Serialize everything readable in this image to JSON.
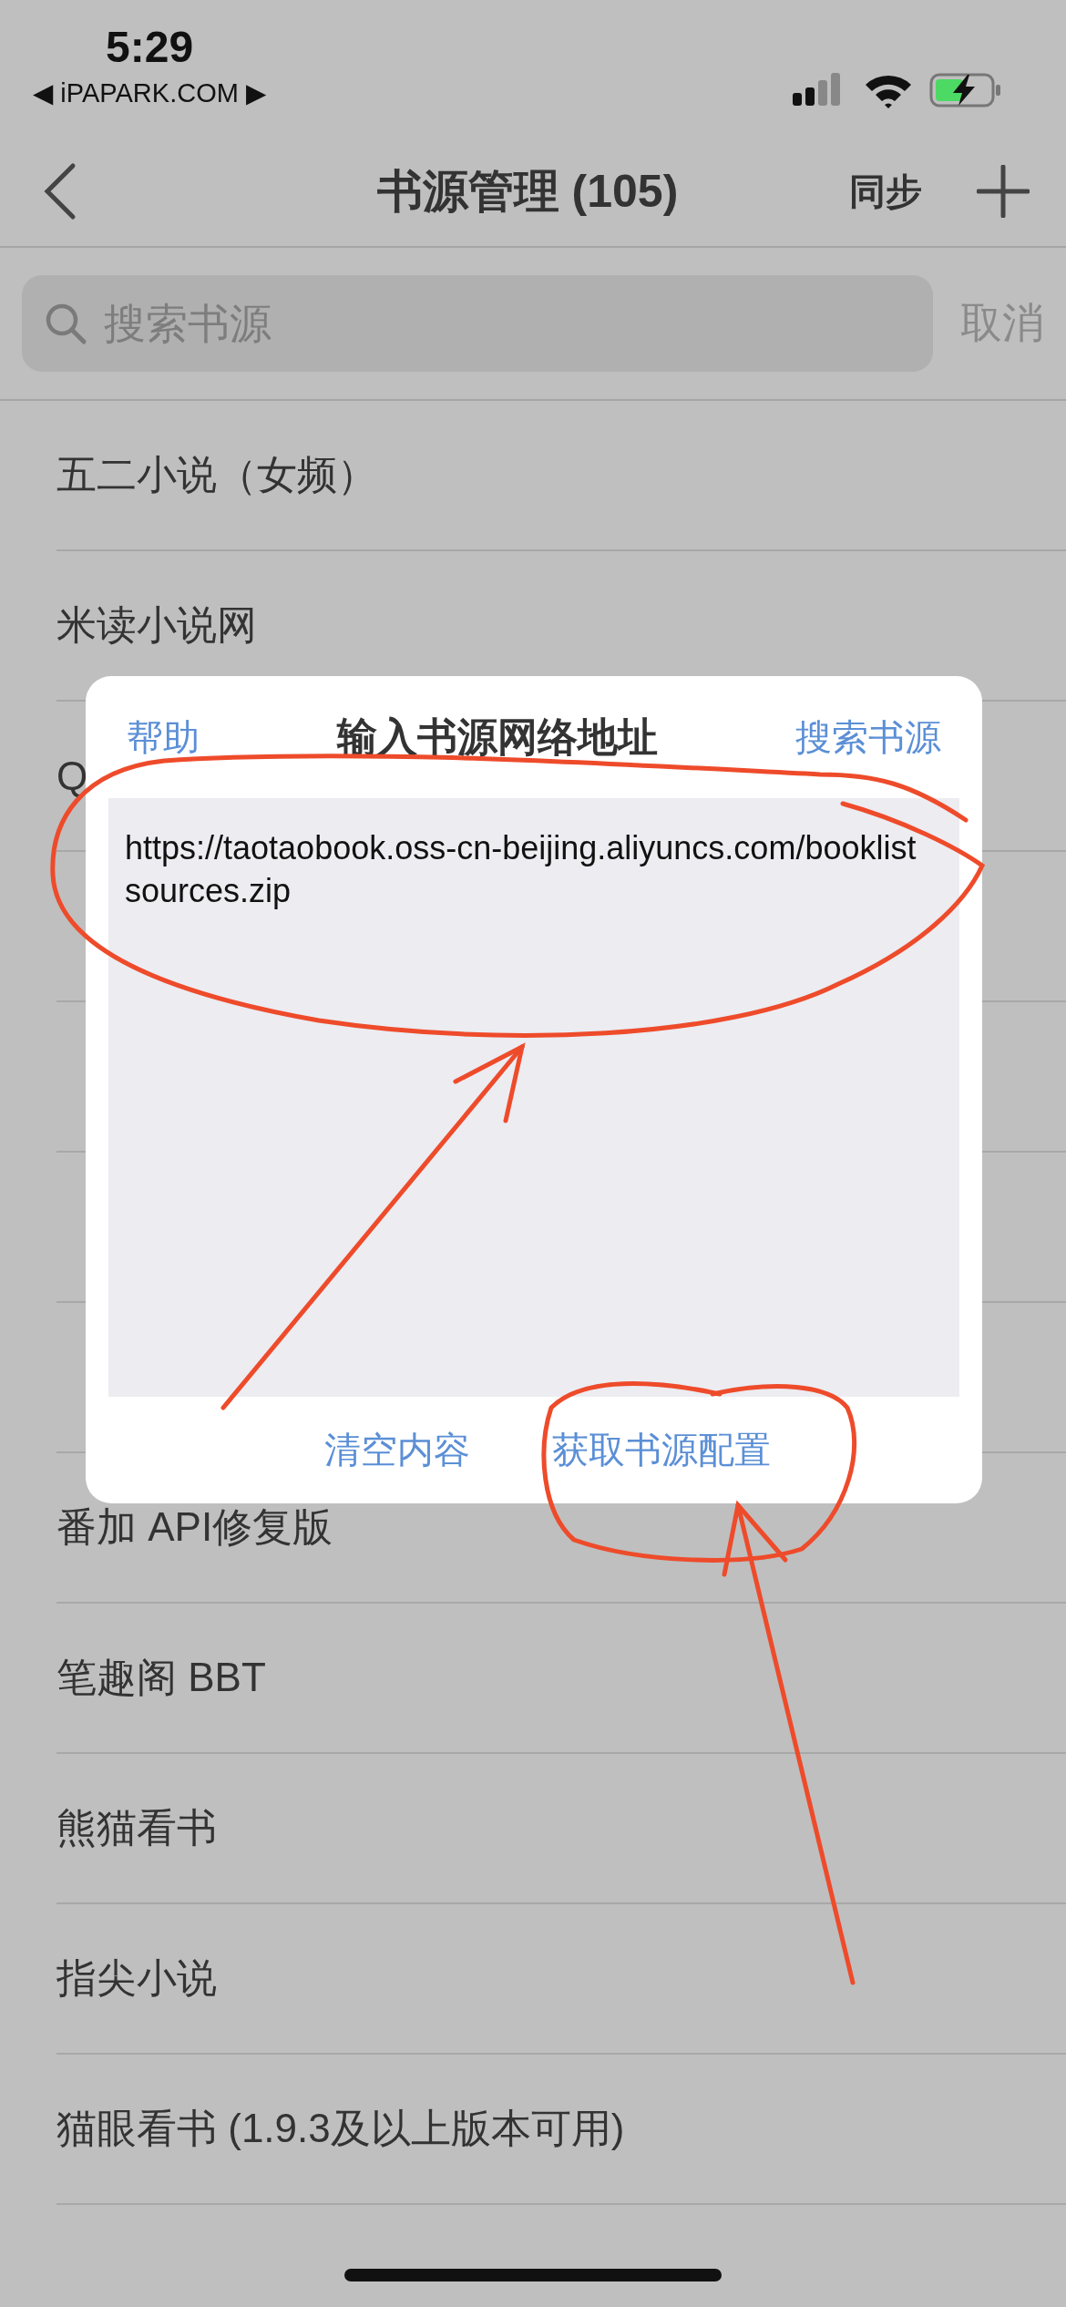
{
  "status_bar": {
    "time": "5:29",
    "back_link": "◀ iPAPARK.COM ▶"
  },
  "nav": {
    "title": "书源管理 (105)",
    "action": "同步"
  },
  "search": {
    "placeholder": "搜索书源",
    "cancel": "取消"
  },
  "sources": [
    {
      "name": "五二小说（女频）"
    },
    {
      "name": "米读小说网"
    },
    {
      "name": "Q"
    }
  ],
  "sources_below_dialog": [
    {
      "name": "番加 API修复版"
    },
    {
      "name": "笔趣阁 BBT"
    },
    {
      "name": "熊猫看书"
    },
    {
      "name": "指尖小说"
    },
    {
      "name": "猫眼看书 (1.9.3及以上版本可用)"
    }
  ],
  "dialog": {
    "title": "输入书源网络地址",
    "left_action": "帮助",
    "right_action": "搜索书源",
    "url": "https://taotaobook.oss-cn-beijing.aliyuncs.com/booklistsources.zip",
    "buttons": [
      "清空内容",
      "获取书源配置"
    ]
  }
}
